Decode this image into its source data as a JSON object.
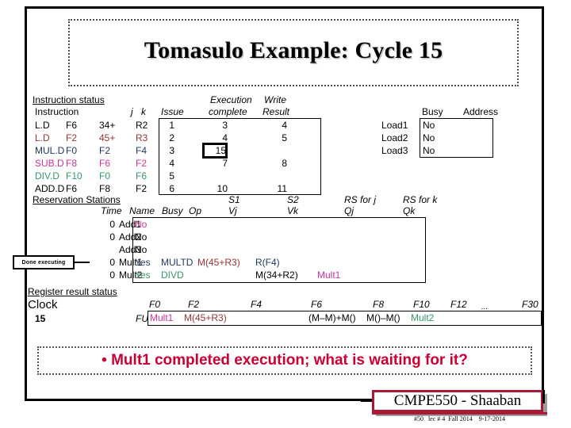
{
  "title": "Tomasulo Example:  Cycle 15",
  "instruction_status": {
    "section_label": "Instruction status",
    "headers": {
      "instruction": "Instruction",
      "j": "j",
      "k": "k",
      "issue": "Issue",
      "exec_line1": "Execution",
      "exec_line2": "complete",
      "write_line1": "Write",
      "write_line2": "Result"
    },
    "rows": [
      {
        "op": "L.D",
        "dest": "F6",
        "j": "34+",
        "k": "R2",
        "issue": "1",
        "exec": "3",
        "write": "4",
        "color": "#000000"
      },
      {
        "op": "L.D",
        "dest": "F2",
        "j": "45+",
        "k": "R3",
        "issue": "2",
        "exec": "4",
        "write": "5",
        "color": "#993333"
      },
      {
        "op": "MUL.D",
        "dest": "F0",
        "j": "F2",
        "k": "F4",
        "issue": "3",
        "exec": "15",
        "write": "",
        "color": "#1f3864"
      },
      {
        "op": "SUB.D",
        "dest": "F8",
        "j": "F6",
        "k": "F2",
        "issue": "4",
        "exec": "7",
        "write": "8",
        "color": "#cc3399"
      },
      {
        "op": "DIV.D",
        "dest": "F10",
        "j": "F0",
        "k": "F6",
        "issue": "5",
        "exec": "",
        "write": "",
        "color": "#339966"
      },
      {
        "op": "ADD.D",
        "dest": "F6",
        "j": "F8",
        "k": "F2",
        "issue": "6",
        "exec": "10",
        "write": "11",
        "color": "#000000"
      }
    ],
    "highlighted_exec_value": "15"
  },
  "load_buffers": {
    "headers": {
      "busy": "Busy",
      "address": "Address"
    },
    "rows": [
      {
        "name": "Load1",
        "busy": "No",
        "address": ""
      },
      {
        "name": "Load2",
        "busy": "No",
        "address": ""
      },
      {
        "name": "Load3",
        "busy": "No",
        "address": ""
      }
    ]
  },
  "reservation_stations": {
    "section_label": "Reservation Stations",
    "group_headers": {
      "s1": "S1",
      "s2": "S2",
      "rs_j": "RS for j",
      "rs_k": "RS for k"
    },
    "headers": {
      "time": "Time",
      "name": "Name",
      "busy": "Busy",
      "op": "Op",
      "vj": "Vj",
      "vk": "Vk",
      "qj": "Qj",
      "qk": "Qk"
    },
    "rows": [
      {
        "time": "0",
        "name": "Add1",
        "busy": "No",
        "op": "",
        "vj": "",
        "vk": "",
        "qj": "",
        "qk": "",
        "busy_color": "#cc3399",
        "op_color": "#000000",
        "vj_color": "#000000",
        "vk_color": "#000000",
        "qj_color": "#000000"
      },
      {
        "time": "0",
        "name": "Add2",
        "busy": "No",
        "op": "",
        "vj": "",
        "vk": "",
        "qj": "",
        "qk": "",
        "busy_color": "#000000",
        "op_color": "#000000",
        "vj_color": "#000000",
        "vk_color": "#000000",
        "qj_color": "#000000"
      },
      {
        "time": "",
        "name": "Add3",
        "busy": "No",
        "op": "",
        "vj": "",
        "vk": "",
        "qj": "",
        "qk": "",
        "busy_color": "#000000",
        "op_color": "#000000",
        "vj_color": "#000000",
        "vk_color": "#000000",
        "qj_color": "#000000"
      },
      {
        "time": "0",
        "name": "Mult1",
        "busy": "Yes",
        "op": "MULTD",
        "vj": "M(45+R3)",
        "vk": "R(F4)",
        "qj": "",
        "qk": "",
        "busy_color": "#1f3864",
        "op_color": "#1f3864",
        "vj_color": "#993333",
        "vk_color": "#1f3864",
        "qj_color": "#000000"
      },
      {
        "time": "0",
        "name": "Mult2",
        "busy": "Yes",
        "op": "DIVD",
        "vj": "",
        "vk": "M(34+R2)",
        "qj": "Mult1",
        "qk": "",
        "busy_color": "#339966",
        "op_color": "#339966",
        "vj_color": "#000000",
        "vk_color": "#000000",
        "qj_color": "#cc3399"
      }
    ]
  },
  "callout": {
    "label": "Done executing"
  },
  "register_status": {
    "section_label": "Register result status",
    "clock_label": "Clock",
    "clock_value": "15",
    "fu_label": "FU",
    "registers": [
      "F0",
      "F2",
      "F4",
      "F6",
      "F8",
      "F10",
      "F12",
      "...",
      "F30"
    ],
    "values": [
      {
        "reg": "F0",
        "value": "Mult1",
        "color": "#cc3399"
      },
      {
        "reg": "F2",
        "value": "M(45+R3)",
        "color": "#993333"
      },
      {
        "reg": "F4",
        "value": "",
        "color": "#000000"
      },
      {
        "reg": "F6",
        "value": "(M–M)+M()",
        "color": "#000000"
      },
      {
        "reg": "F8",
        "value": "M()–M()",
        "color": "#000000"
      },
      {
        "reg": "F10",
        "value": "Mult2",
        "color": "#339966"
      },
      {
        "reg": "F12",
        "value": "",
        "color": "#000000"
      },
      {
        "reg": "...",
        "value": "",
        "color": "#000000"
      },
      {
        "reg": "F30",
        "value": "",
        "color": "#000000"
      }
    ]
  },
  "bullet": "• Mult1 completed execution; what is waiting for it?",
  "footer": {
    "course": "CMPE550 - Shaaban",
    "subline": "#50   lec # 4  Fall 2014    9-17-2014"
  },
  "colors": {
    "accent_red": "#cc0033",
    "footer_border": "#a81a35",
    "magenta": "#cc3399",
    "navy": "#1f3864",
    "green": "#339966",
    "maroon": "#993333"
  }
}
